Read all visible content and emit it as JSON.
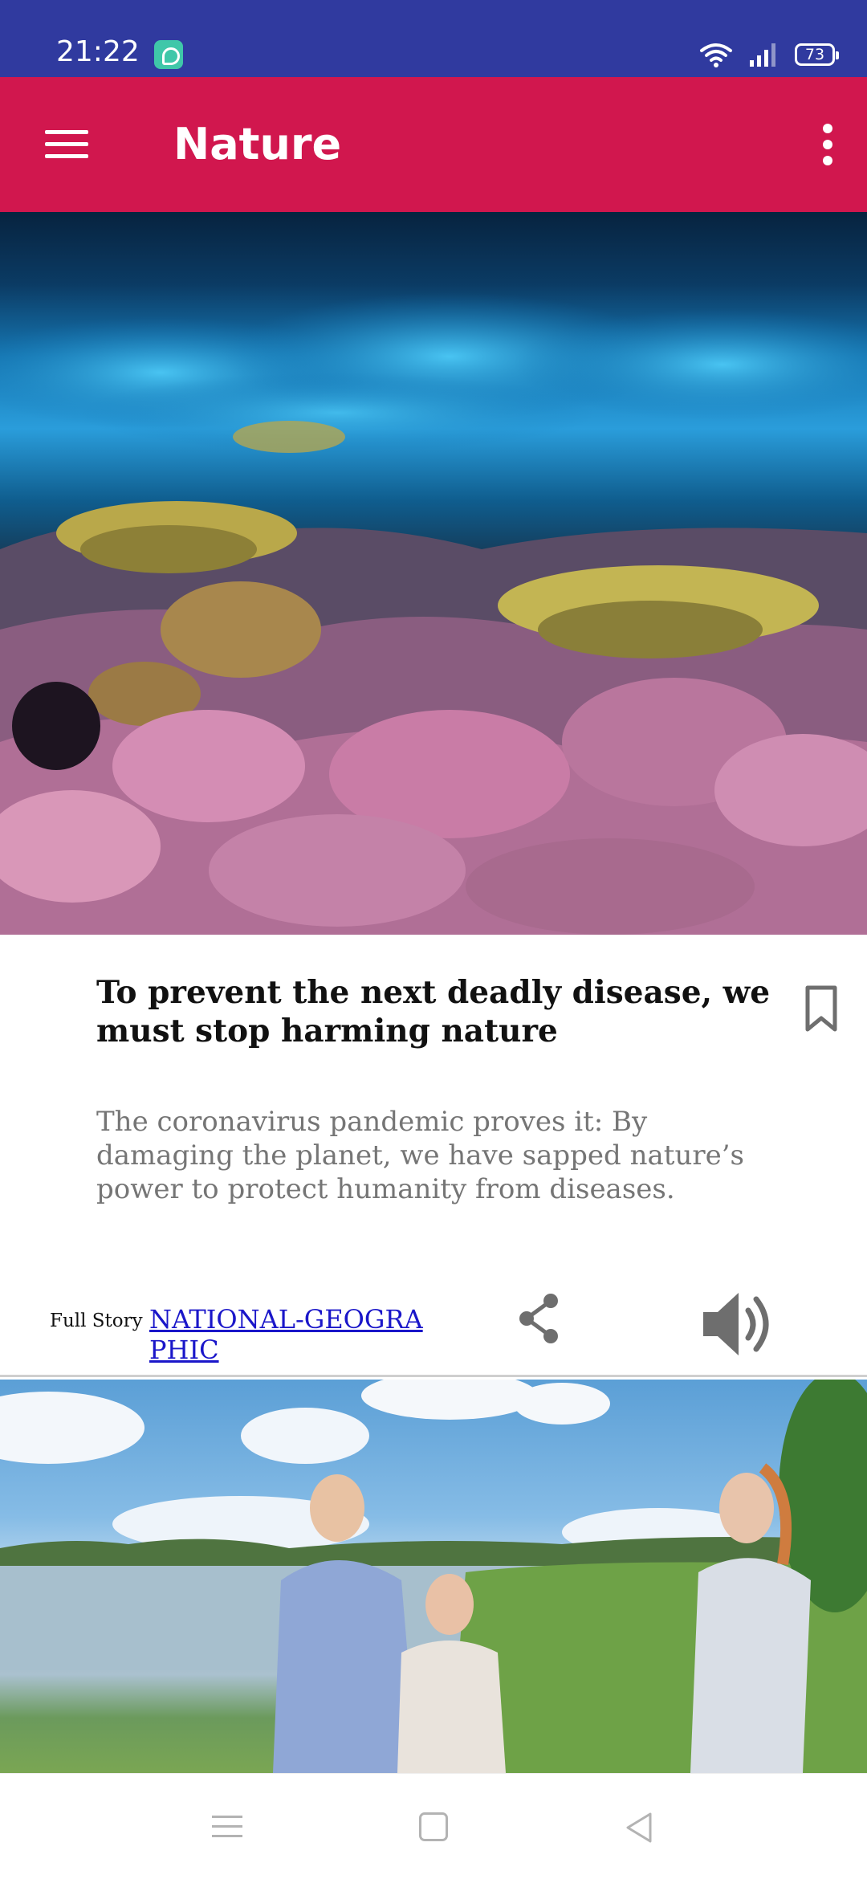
{
  "status_bar": {
    "time": "21:22",
    "battery": "73",
    "app_icon": "chat-bubble-icon",
    "wifi_icon": "wifi-icon",
    "signal_icon": "signal-bars-icon"
  },
  "app_bar": {
    "title": "Nature",
    "menu_icon": "hamburger-menu-icon",
    "overflow_icon": "more-vert-icon",
    "color": "#d1174e"
  },
  "colors": {
    "status_bar": "#303a9f",
    "accent": "#d1174e",
    "link": "#1a16c9",
    "summary_text": "#757575"
  },
  "feed": {
    "articles": [
      {
        "image": "coral-reef-photo",
        "headline": "To prevent the next deadly disease, we must stop harming nature",
        "summary": "The coronavirus pandemic proves it: By damaging the planet, we have sapped nature’s power to protect humanity from diseases.",
        "full_story_label": "Full Story",
        "source": "NATIONAL-GEOGRAPHIC",
        "bookmark_icon": "bookmark-outline-icon",
        "share_icon": "share-icon",
        "speaker_icon": "speaker-icon"
      },
      {
        "image": "family-by-lake-photo"
      }
    ]
  },
  "nav_bar": {
    "recents_icon": "recents-icon",
    "home_icon": "home-icon",
    "back_icon": "back-icon"
  }
}
